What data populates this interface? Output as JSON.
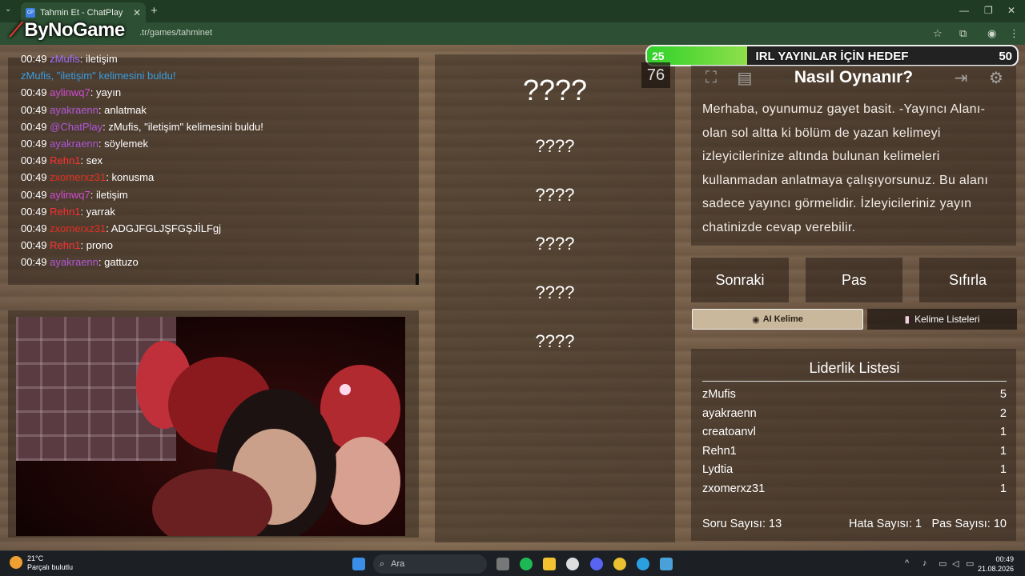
{
  "browser": {
    "tab_title": "Tahmin Et - ChatPlay",
    "tab_favicon": "CP",
    "url_visible": ".tr/games/tahminet",
    "logo": "ByNoGame"
  },
  "chat": {
    "messages": [
      {
        "time": "00:49",
        "user": "zMufis",
        "text": ": iletişim",
        "color": "#a070ff"
      },
      {
        "time": "",
        "user": "zMufis,",
        "text": " \"iletişim\" kelimesini buldu!",
        "color": "#3a9ee0",
        "full_line": true
      },
      {
        "time": "00:49",
        "user": "aylinwq7",
        "text": ": yayın",
        "color": "#d04bd0"
      },
      {
        "time": "00:49",
        "user": "ayakraenn",
        "text": ": anlatmak",
        "color": "#b057d8"
      },
      {
        "time": "00:49",
        "user": "@ChatPlay",
        "text": ": zMufis, \"iletişim\" kelimesini buldu!",
        "color": "#b057d8"
      },
      {
        "time": "00:49",
        "user": "ayakraenn",
        "text": ": söylemek",
        "color": "#b057d8"
      },
      {
        "time": "00:49",
        "user": "Rehn1",
        "text": ": sex",
        "color": "#ff3030"
      },
      {
        "time": "00:49",
        "user": "zxomerxz31",
        "text": ": konusma",
        "color": "#e03020"
      },
      {
        "time": "00:49",
        "user": "aylinwq7",
        "text": ": iletişim",
        "color": "#d04bd0"
      },
      {
        "time": "00:49",
        "user": "Rehn1",
        "text": ": yarrak",
        "color": "#ff3030"
      },
      {
        "time": "00:49",
        "user": "zxomerxz31",
        "text": ": ADGJFGLJŞFGŞJİLFgj",
        "color": "#e03020"
      },
      {
        "time": "00:49",
        "user": "Rehn1",
        "text": ": prono",
        "color": "#ff3030"
      },
      {
        "time": "00:49",
        "user": "ayakraenn",
        "text": ": gattuzo",
        "color": "#b057d8"
      }
    ]
  },
  "words": {
    "main": "????",
    "items": [
      "????",
      "????",
      "????",
      "????",
      "????"
    ]
  },
  "goal": {
    "min": "25",
    "label": "IRL YAYINLAR İÇİN HEDEF",
    "max": "50",
    "progress_fraction": 0.27
  },
  "timer": "76",
  "howto": {
    "title": "Nasıl Oynanır?",
    "text": "Merhaba, oyunumuz gayet basit. -Yayıncı Alanı- olan sol altta ki bölüm de yazan kelimeyi izleyicilerinize altında bulunan kelimeleri kullanmadan anlatmaya çalışıyorsunuz. Bu alanı sadece yayıncı görmelidir. İzleyicileriniz yayın chatinizde cevap verebilir."
  },
  "buttons": {
    "next": "Sonraki",
    "pass": "Pas",
    "reset": "Sıfırla",
    "ai_word": "AI Kelime",
    "word_lists": "Kelime Listeleri"
  },
  "leaderboard": {
    "title": "Liderlik Listesi",
    "rows": [
      {
        "name": "zMufis",
        "score": "5"
      },
      {
        "name": "ayakraenn",
        "score": "2"
      },
      {
        "name": "creatoanvl",
        "score": "1"
      },
      {
        "name": "Rehn1",
        "score": "1"
      },
      {
        "name": "Lydtia",
        "score": "1"
      },
      {
        "name": "zxomerxz31",
        "score": "1"
      }
    ],
    "questions": "Soru Sayısı: 13",
    "errors": "Hata Sayısı: 1",
    "passes": "Pas Sayısı: 10"
  },
  "taskbar": {
    "temp": "21°C",
    "weather": "Parçalı bulutlu",
    "search": "Ara",
    "time": "00:49",
    "date": "21.08.2026"
  }
}
